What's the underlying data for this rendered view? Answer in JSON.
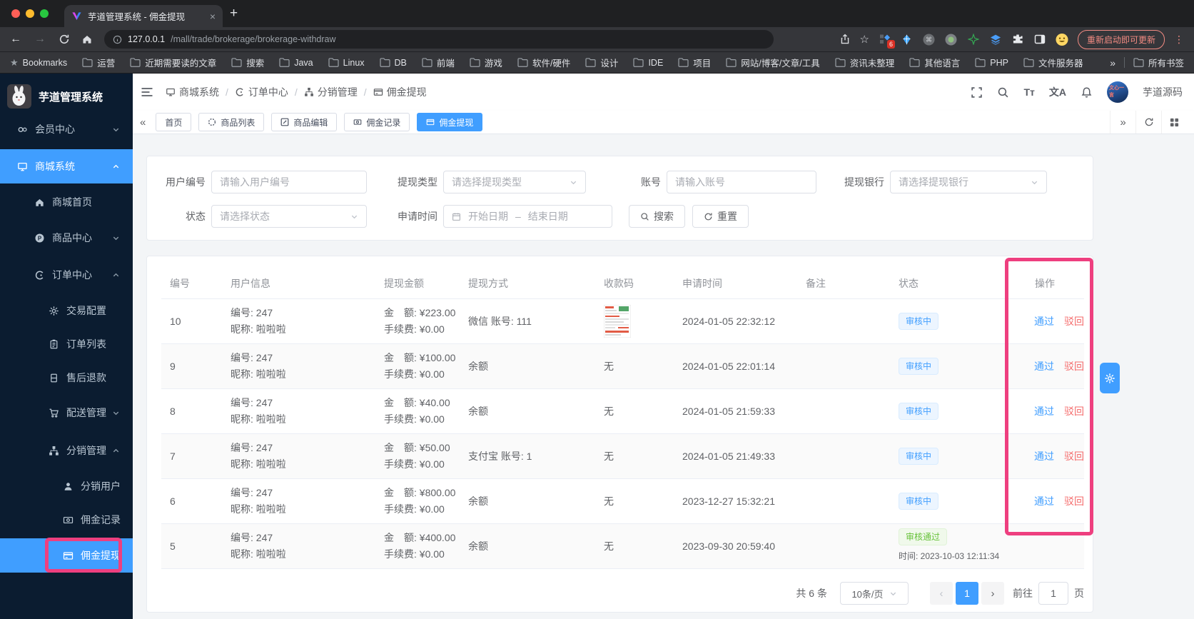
{
  "browser": {
    "tab_title": "芋道管理系统 - 佣金提现",
    "url_host": "127.0.0.1",
    "url_path": "/mall/trade/brokerage/brokerage-withdraw",
    "update_button": "重新启动即可更新",
    "extension_badge": "6",
    "bookmarks_label": "Bookmarks",
    "bookmarks": [
      "运营",
      "近期需要读的文章",
      "搜索",
      "Java",
      "Linux",
      "DB",
      "前端",
      "游戏",
      "软件/硬件",
      "设计",
      "IDE",
      "项目",
      "网站/博客/文章/工具",
      "资讯未整理",
      "其他语言",
      "PHP",
      "文件服务器"
    ],
    "all_bookmarks": "所有书签"
  },
  "glyphs": {
    "back": "←",
    "forward": "→",
    "plus": "+",
    "close": "×",
    "star": "☆",
    "bookmark_star": "★",
    "overflow": "»",
    "dots": "⋮",
    "collapse": "«",
    "expand": "»",
    "prev": "‹",
    "next": "›",
    "slash": "/",
    "font_size": "Tт",
    "locale": "文A",
    "cmd": "⌘"
  },
  "sidebar": {
    "title": "芋道管理系统",
    "items": [
      {
        "label": "会员中心"
      },
      {
        "label": "商城系统"
      },
      {
        "label": "商城首页"
      },
      {
        "label": "商品中心"
      },
      {
        "label": "订单中心"
      },
      {
        "label": "交易配置"
      },
      {
        "label": "订单列表"
      },
      {
        "label": "售后退款"
      },
      {
        "label": "配送管理"
      },
      {
        "label": "分销管理"
      },
      {
        "label": "分销用户"
      },
      {
        "label": "佣金记录"
      },
      {
        "label": "佣金提现"
      }
    ]
  },
  "navbar": {
    "breadcrumb": [
      {
        "label": "商城系统"
      },
      {
        "label": "订单中心"
      },
      {
        "label": "分销管理"
      },
      {
        "label": "佣金提现"
      }
    ],
    "username": "芋道源码"
  },
  "tags": {
    "items": [
      {
        "label": "首页"
      },
      {
        "label": "商品列表"
      },
      {
        "label": "商品编辑"
      },
      {
        "label": "佣金记录"
      },
      {
        "label": "佣金提现"
      }
    ]
  },
  "filters": {
    "user_no": {
      "label": "用户编号",
      "placeholder": "请输入用户编号"
    },
    "type": {
      "label": "提现类型",
      "placeholder": "请选择提现类型"
    },
    "account": {
      "label": "账号",
      "placeholder": "请输入账号"
    },
    "bank": {
      "label": "提现银行",
      "placeholder": "请选择提现银行"
    },
    "status": {
      "label": "状态",
      "placeholder": "请选择状态"
    },
    "apply_time": {
      "label": "申请时间",
      "start_placeholder": "开始日期",
      "separator": "–",
      "end_placeholder": "结束日期"
    },
    "search_label": "搜索",
    "reset_label": "重置"
  },
  "table": {
    "columns": [
      "编号",
      "用户信息",
      "提现金额",
      "提现方式",
      "收款码",
      "申请时间",
      "备注",
      "状态",
      "操作"
    ],
    "rows": [
      {
        "id": "10",
        "user_no": "编号: 247",
        "nickname": "昵称: 啦啦啦",
        "amount": "金　额: ¥223.00",
        "fee": "手续费: ¥0.00",
        "method": "微信 账号: 111",
        "code": "",
        "time": "2024-01-05 22:32:12",
        "remark": "",
        "status": "审核中",
        "approve": "通过",
        "reject": "驳回"
      },
      {
        "id": "9",
        "user_no": "编号: 247",
        "nickname": "昵称: 啦啦啦",
        "amount": "金　额: ¥100.00",
        "fee": "手续费: ¥0.00",
        "method": "余额",
        "code": "无",
        "time": "2024-01-05 22:01:14",
        "remark": "",
        "status": "审核中",
        "approve": "通过",
        "reject": "驳回"
      },
      {
        "id": "8",
        "user_no": "编号: 247",
        "nickname": "昵称: 啦啦啦",
        "amount": "金　额: ¥40.00",
        "fee": "手续费: ¥0.00",
        "method": "余额",
        "code": "无",
        "time": "2024-01-05 21:59:33",
        "remark": "",
        "status": "审核中",
        "approve": "通过",
        "reject": "驳回"
      },
      {
        "id": "7",
        "user_no": "编号: 247",
        "nickname": "昵称: 啦啦啦",
        "amount": "金　额: ¥50.00",
        "fee": "手续费: ¥0.00",
        "method": "支付宝 账号: 1",
        "code": "无",
        "time": "2024-01-05 21:49:33",
        "remark": "",
        "status": "审核中",
        "approve": "通过",
        "reject": "驳回"
      },
      {
        "id": "6",
        "user_no": "编号: 247",
        "nickname": "昵称: 啦啦啦",
        "amount": "金　额: ¥800.00",
        "fee": "手续费: ¥0.00",
        "method": "余额",
        "code": "无",
        "time": "2023-12-27 15:32:21",
        "remark": "",
        "status": "审核中",
        "approve": "通过",
        "reject": "驳回"
      },
      {
        "id": "5",
        "user_no": "编号: 247",
        "nickname": "昵称: 啦啦啦",
        "amount": "金　额: ¥400.00",
        "fee": "手续费: ¥0.00",
        "method": "余额",
        "code": "无",
        "time": "2023-09-30 20:59:40",
        "remark": "",
        "status": "审核通过",
        "audit_time": "时间: 2023-10-03 12:11:34"
      }
    ]
  },
  "pagination": {
    "total": "共 6 条",
    "page_size": "10条/页",
    "page": "1",
    "goto_label": "前往",
    "goto_value": "1",
    "unit": "页"
  },
  "colors": {
    "primary": "#409eff",
    "danger": "#f56c6c",
    "success": "#67c23a",
    "annotation": "#ee3f7f",
    "sidebar_bg": "#0b1c30"
  }
}
